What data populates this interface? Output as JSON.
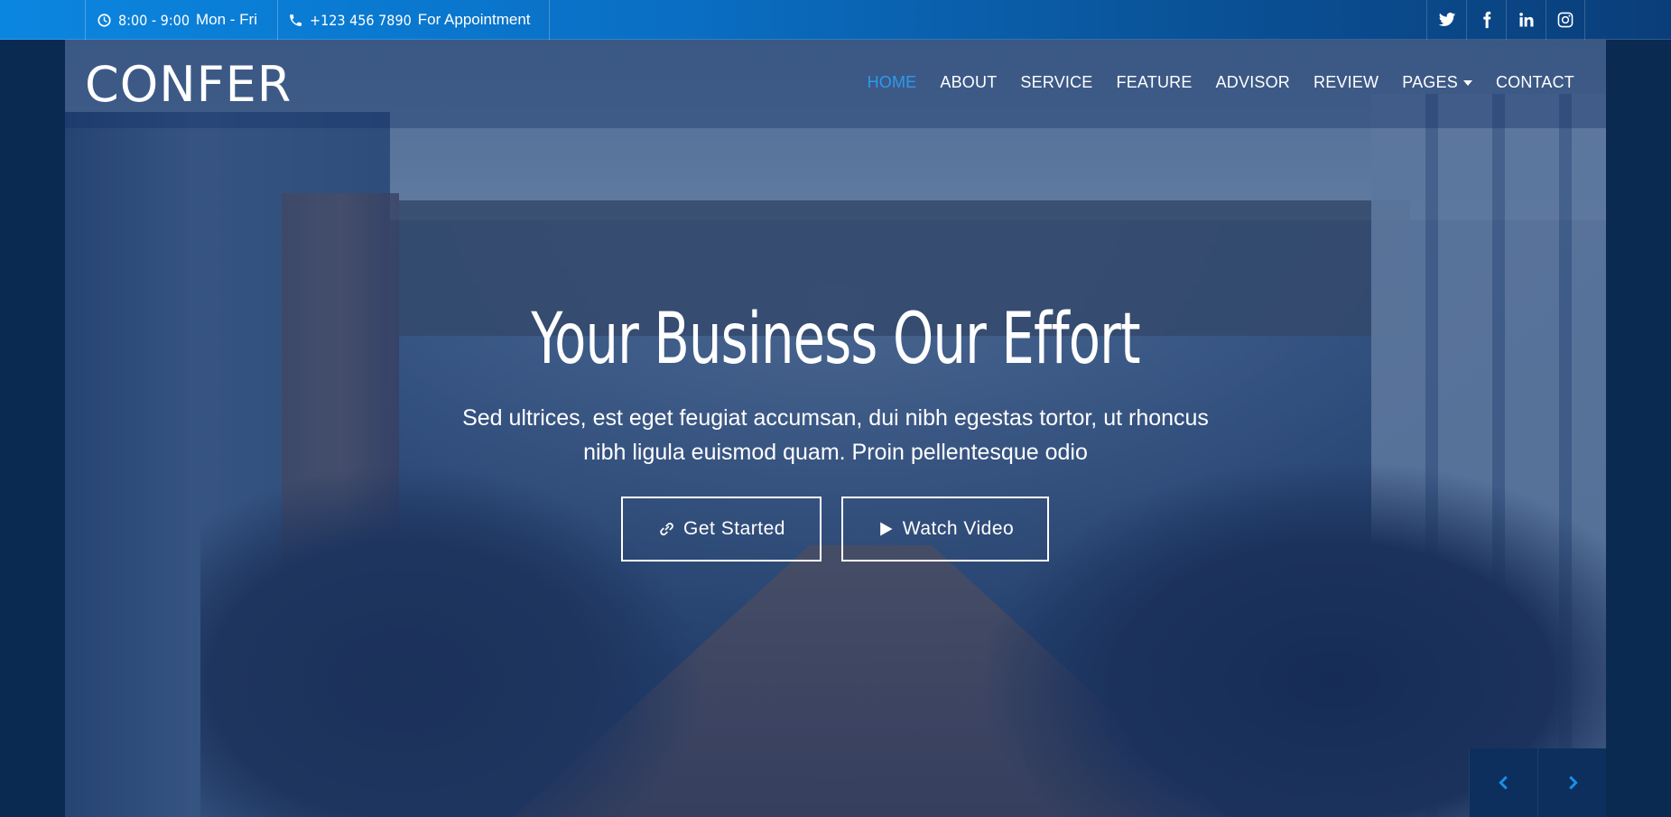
{
  "topbar": {
    "hours_time": "8:00 - 9:00",
    "hours_days": "Mon - Fri",
    "phone_number": "+123 456 7890",
    "phone_label": "For Appointment",
    "social": [
      "twitter-icon",
      "facebook-icon",
      "linkedin-icon",
      "instagram-icon"
    ]
  },
  "brand": {
    "logo": "CONFER"
  },
  "nav": {
    "items": [
      "HOME",
      "ABOUT",
      "SERVICE",
      "FEATURE",
      "ADVISOR",
      "REVIEW",
      "PAGES",
      "CONTACT"
    ],
    "active": "HOME"
  },
  "hero": {
    "title": "Your Business Our Effort",
    "subtitle": "Sed ultrices, est eget feugiat accumsan, dui nibh egestas tortor, ut rhoncus nibh ligula euismod quam. Proin pellentesque odio",
    "primary_button": "Get Started",
    "secondary_button": "Watch Video"
  },
  "colors": {
    "accent": "#2a9bf0",
    "topbar_start": "#0b86e0",
    "topbar_end": "#0a3e7a",
    "page_bg": "#0a2a52"
  }
}
